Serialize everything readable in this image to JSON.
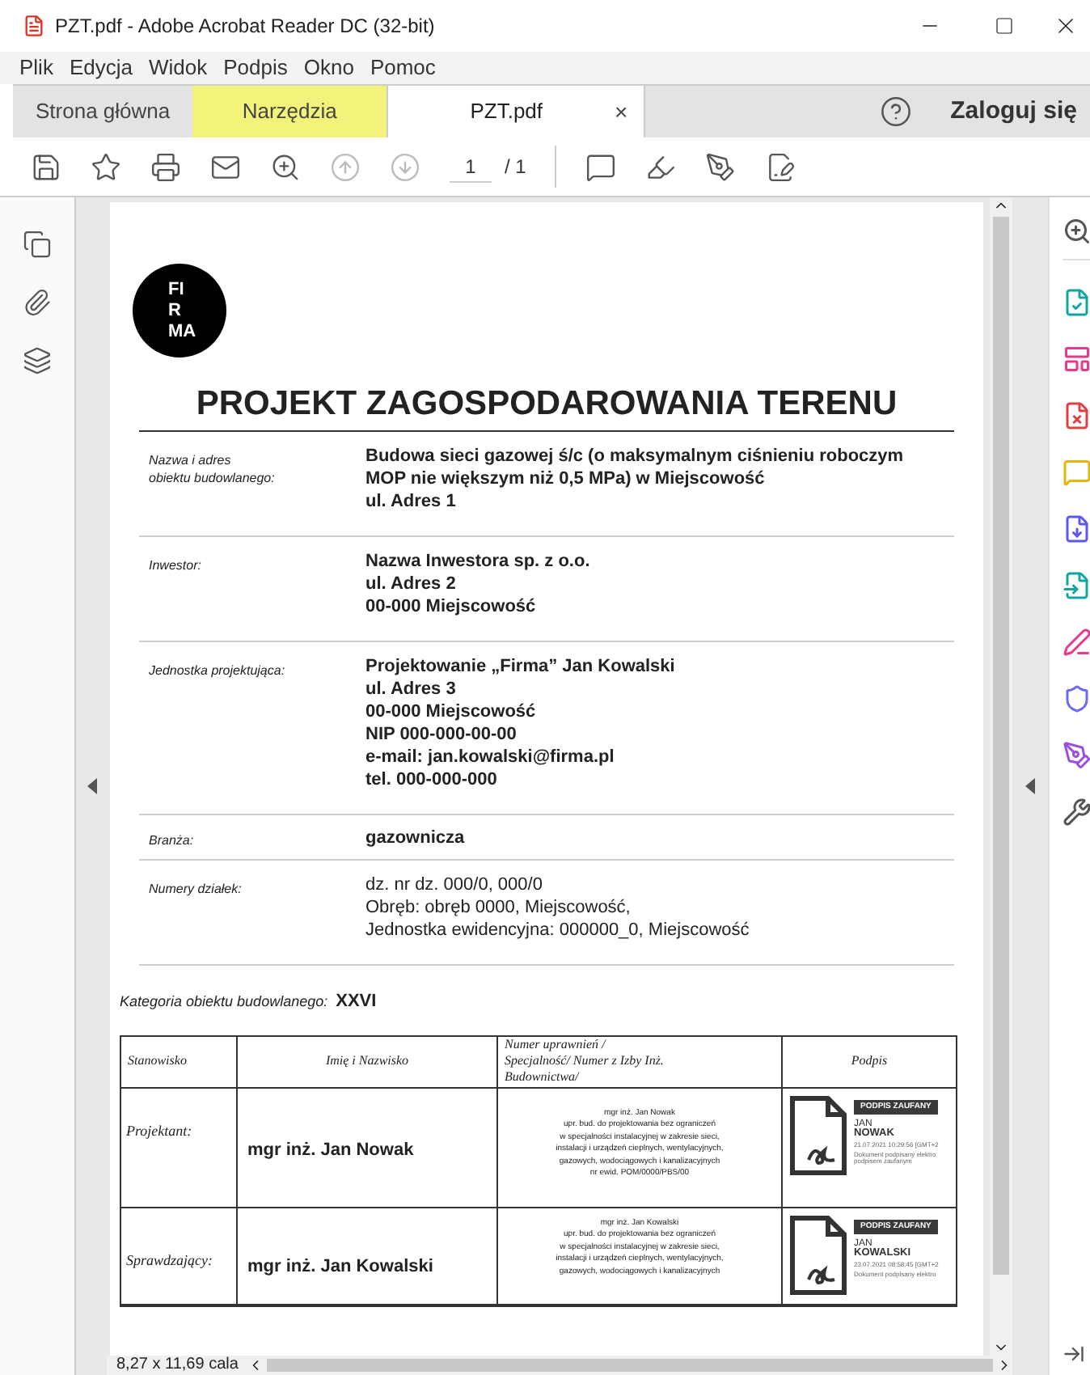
{
  "window": {
    "title": "PZT.pdf - Adobe Acrobat Reader DC (32-bit)"
  },
  "menu": [
    "Plik",
    "Edycja",
    "Widok",
    "Podpis",
    "Okno",
    "Pomoc"
  ],
  "tabs": [
    {
      "label": "Strona główna",
      "selected": false,
      "closable": false,
      "highlighted": false
    },
    {
      "label": "Narzędzia",
      "selected": false,
      "closable": false,
      "highlighted": true
    },
    {
      "label": "PZT.pdf",
      "selected": true,
      "closable": true,
      "highlighted": false
    }
  ],
  "close_glyph": "×",
  "login": "Zaloguj się",
  "toolbar": {
    "page_current": "1",
    "page_total": "/ 1"
  },
  "document": {
    "logo_lines": [
      "FI",
      "R",
      "MA"
    ],
    "title": "PROJEKT ZAGOSPODAROWANIA TERENU",
    "fields": [
      {
        "label": "Nazwa i adres\nobiektu budowlanego:",
        "lines": [
          "Budowa sieci gazowej ś/c (o maksymalnym ciśnieniu roboczym",
          "MOP nie większym niż 0,5 MPa) w Miejscowość",
          "ul. Adres 1"
        ],
        "bold": true
      },
      {
        "label": "Inwestor:",
        "lines": [
          "Nazwa Inwestora sp. z o.o.",
          "ul. Adres 2",
          "00-000 Miejscowość"
        ],
        "bold": true
      },
      {
        "label": "Jednostka projektująca:",
        "lines": [
          "Projektowanie „Firma” Jan Kowalski",
          "ul. Adres 3",
          "00-000 Miejscowość",
          "NIP 000-000-00-00",
          "e-mail: jan.kowalski@firma.pl",
          "tel. 000-000-000"
        ],
        "bold": true
      },
      {
        "label": "Branża:",
        "lines": [
          "gazownicza"
        ],
        "bold": true
      },
      {
        "label": "Numery działek:",
        "lines": [
          "dz. nr  dz. 000/0, 000/0",
          "Obręb: obręb 0000, Miejscowość,",
          "Jednostka ewidencyjna: 000000_0, Miejscowość"
        ],
        "bold": false
      }
    ],
    "category_label": "Kategoria obiektu budowlanego:",
    "category_value": "XXVI",
    "columns": [
      "Stanowisko",
      "Imię i Nazwisko",
      "Numer uprawnień /\nSpecjalność/ Numer z Izby Inż.\nBudownictwa/",
      "Podpis"
    ],
    "rows": [
      {
        "role": "Projektant:",
        "name": "mgr inż. Jan Nowak",
        "credentials": [
          "mgr inż. Jan Nowak",
          "upr. bud. do projektowania bez ograniczeń",
          "w specjalności instalacyjnej w zakresie sieci,",
          "instalacji i urządzeń cieplnych, wentylacyjnych,",
          "gazowych, wodociągowych i kanalizacyjnych",
          "nr ewid. POM/0000/PBS/00"
        ],
        "signature": {
          "badge": "PODPIS ZAUFANY",
          "first": "JAN",
          "last": "NOWAK",
          "date": "21.07.2021 10:29:56 [GMT+2",
          "note": "Dokument podpisany elektro\npodpisem zaufanym"
        }
      },
      {
        "role": "Sprawdzający:",
        "name": "mgr inż. Jan Kowalski",
        "credentials": [
          "mgr inż. Jan Kowalski",
          "upr. bud. do projektowania bez ograniczeń",
          "w specjalności instalacyjnej w zakresie sieci,",
          "instalacji i urządzeń cieplnych, wentylacyjnych,",
          "gazowych, wodociągowych i kanalizacyjnych"
        ],
        "signature": {
          "badge": "PODPIS ZAUFANY",
          "first": "JAN",
          "last": "KOWALSKI",
          "date": "23.07.2021 08:58:45 [GMT+2",
          "note": "Dokument podpisany elektro"
        }
      }
    ]
  },
  "status": {
    "page_size": "8,27 x 11,69 cala"
  }
}
